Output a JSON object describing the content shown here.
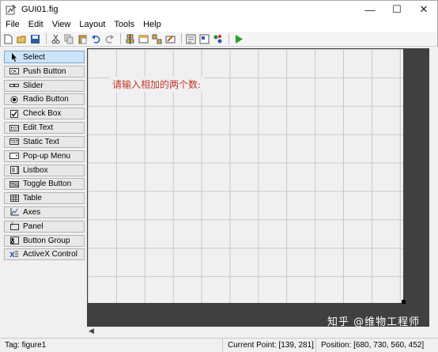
{
  "window": {
    "title": "GUI01.fig",
    "controls": {
      "minimize": "—",
      "maximize": "☐",
      "close": "✕"
    }
  },
  "menu": [
    "File",
    "Edit",
    "View",
    "Layout",
    "Tools",
    "Help"
  ],
  "toolbar_icons": [
    "new-icon",
    "open-icon",
    "save-icon",
    "cut-icon",
    "copy-icon",
    "paste-icon",
    "undo-icon",
    "redo-icon",
    "align-icon",
    "menu-editor-icon",
    "tab-order-icon",
    "toolbar-editor-icon",
    "mfile-editor-icon",
    "property-inspector-icon",
    "object-browser-icon",
    "run-icon"
  ],
  "palette": [
    {
      "label": "Select",
      "icon": "cursor-icon",
      "selected": true
    },
    {
      "label": "Push Button",
      "icon": "push-button-icon"
    },
    {
      "label": "Slider",
      "icon": "slider-icon"
    },
    {
      "label": "Radio Button",
      "icon": "radio-button-icon"
    },
    {
      "label": "Check Box",
      "icon": "checkbox-icon"
    },
    {
      "label": "Edit Text",
      "icon": "edit-text-icon"
    },
    {
      "label": "Static Text",
      "icon": "static-text-icon"
    },
    {
      "label": "Pop-up Menu",
      "icon": "popup-menu-icon"
    },
    {
      "label": "Listbox",
      "icon": "listbox-icon"
    },
    {
      "label": "Toggle Button",
      "icon": "toggle-button-icon"
    },
    {
      "label": "Table",
      "icon": "table-icon"
    },
    {
      "label": "Axes",
      "icon": "axes-icon"
    },
    {
      "label": "Panel",
      "icon": "panel-icon"
    },
    {
      "label": "Button Group",
      "icon": "button-group-icon"
    },
    {
      "label": "ActiveX Control",
      "icon": "activex-icon"
    }
  ],
  "canvas": {
    "static_text": "请输入相加的两个数:"
  },
  "status": {
    "tag": "Tag: figure1",
    "current_point": "Current Point:  [139, 281]",
    "position": "Position: [680, 730, 560, 452]"
  },
  "watermark": "知乎 @维物工程师",
  "colors": {
    "canvas_text": "#c0392b",
    "canvas_border": "#404040",
    "selected": "#cce4f7"
  }
}
